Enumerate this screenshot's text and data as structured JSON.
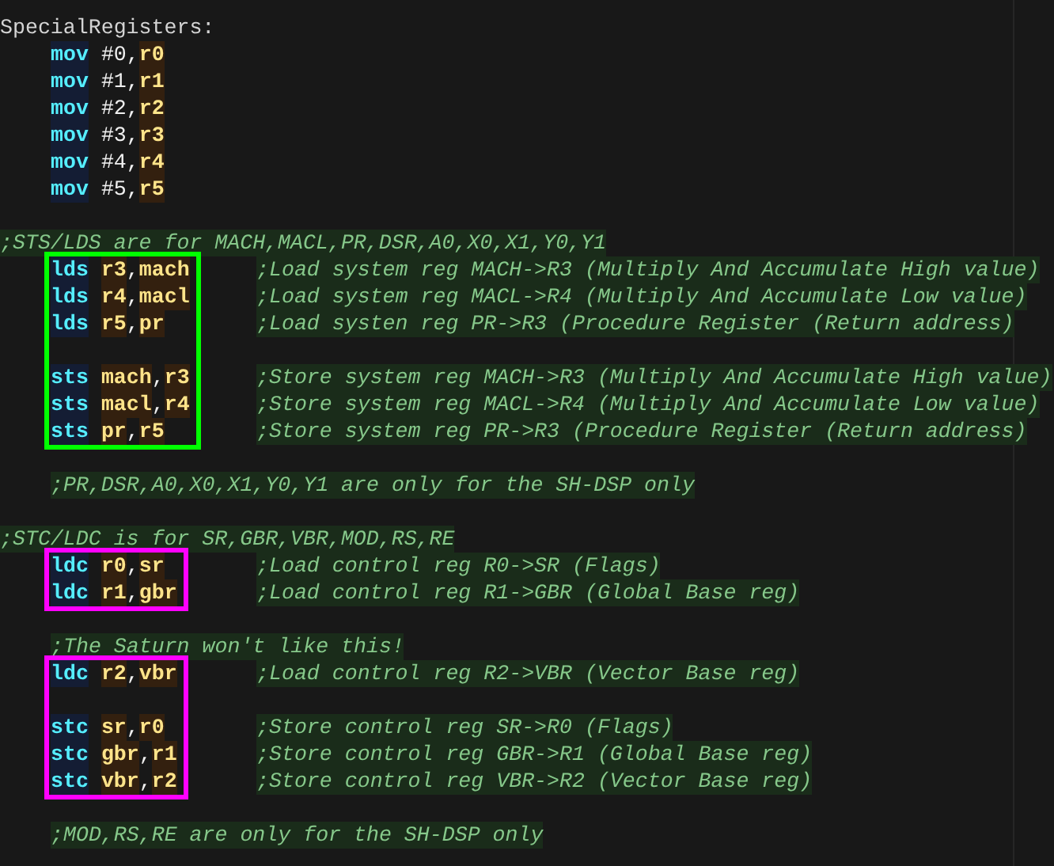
{
  "lines": [
    {
      "kind": "label",
      "text": "SpecialRegisters:"
    },
    {
      "kind": "instr",
      "op": "mov",
      "args": [
        {
          "kind": "imm",
          "text": "#0"
        },
        {
          "kind": "sep",
          "text": ","
        },
        {
          "kind": "reg",
          "text": "r0"
        }
      ]
    },
    {
      "kind": "instr",
      "op": "mov",
      "args": [
        {
          "kind": "imm",
          "text": "#1"
        },
        {
          "kind": "sep",
          "text": ","
        },
        {
          "kind": "reg",
          "text": "r1"
        }
      ]
    },
    {
      "kind": "instr",
      "op": "mov",
      "args": [
        {
          "kind": "imm",
          "text": "#2"
        },
        {
          "kind": "sep",
          "text": ","
        },
        {
          "kind": "reg",
          "text": "r2"
        }
      ]
    },
    {
      "kind": "instr",
      "op": "mov",
      "args": [
        {
          "kind": "imm",
          "text": "#3"
        },
        {
          "kind": "sep",
          "text": ","
        },
        {
          "kind": "reg",
          "text": "r3"
        }
      ]
    },
    {
      "kind": "instr",
      "op": "mov",
      "args": [
        {
          "kind": "imm",
          "text": "#4"
        },
        {
          "kind": "sep",
          "text": ","
        },
        {
          "kind": "reg",
          "text": "r4"
        }
      ]
    },
    {
      "kind": "instr",
      "op": "mov",
      "args": [
        {
          "kind": "imm",
          "text": "#5"
        },
        {
          "kind": "sep",
          "text": ","
        },
        {
          "kind": "reg",
          "text": "r5"
        }
      ]
    },
    {
      "kind": "blank"
    },
    {
      "kind": "comment",
      "indented": false,
      "text": ";STS/LDS are for MACH,MACL,PR,DSR,A0,X0,X1,Y0,Y1"
    },
    {
      "kind": "block",
      "color": "#00ff00",
      "rows": [
        {
          "kind": "instr",
          "op": "lds",
          "args": [
            {
              "kind": "reg",
              "text": "r3"
            },
            {
              "kind": "sep",
              "text": ","
            },
            {
              "kind": "reg",
              "text": "mach"
            }
          ],
          "comment": ";Load system reg MACH->R3 (Multiply And Accumulate High value)"
        },
        {
          "kind": "instr",
          "op": "lds",
          "args": [
            {
              "kind": "reg",
              "text": "r4"
            },
            {
              "kind": "sep",
              "text": ","
            },
            {
              "kind": "reg",
              "text": "macl"
            }
          ],
          "comment": ";Load system reg MACL->R4 (Multiply And Accumulate Low value)"
        },
        {
          "kind": "instr",
          "op": "lds",
          "args": [
            {
              "kind": "reg",
              "text": "r5"
            },
            {
              "kind": "sep",
              "text": ","
            },
            {
              "kind": "reg",
              "text": "pr"
            }
          ],
          "comment": ";Load systen reg PR->R3 (Procedure Register (Return address)"
        },
        {
          "kind": "blank"
        },
        {
          "kind": "instr",
          "op": "sts",
          "args": [
            {
              "kind": "reg",
              "text": "mach"
            },
            {
              "kind": "sep",
              "text": ","
            },
            {
              "kind": "reg",
              "text": "r3"
            }
          ],
          "comment": ";Store system reg MACH->R3 (Multiply And Accumulate High value)"
        },
        {
          "kind": "instr",
          "op": "sts",
          "args": [
            {
              "kind": "reg",
              "text": "macl"
            },
            {
              "kind": "sep",
              "text": ","
            },
            {
              "kind": "reg",
              "text": "r4"
            }
          ],
          "comment": ";Store system reg MACL->R4 (Multiply And Accumulate Low value)"
        },
        {
          "kind": "instr",
          "op": "sts",
          "args": [
            {
              "kind": "reg",
              "text": "pr"
            },
            {
              "kind": "sep",
              "text": ","
            },
            {
              "kind": "reg",
              "text": "r5"
            }
          ],
          "comment": ";Store system reg PR->R3 (Procedure Register (Return address)"
        }
      ]
    },
    {
      "kind": "blank"
    },
    {
      "kind": "comment",
      "indented": true,
      "text": ";PR,DSR,A0,X0,X1,Y0,Y1 are only for the SH-DSP only"
    },
    {
      "kind": "blank"
    },
    {
      "kind": "comment",
      "indented": false,
      "text": ";STC/LDC is for SR,GBR,VBR,MOD,RS,RE"
    },
    {
      "kind": "block",
      "color": "#ff00ff",
      "rows": [
        {
          "kind": "instr",
          "op": "ldc",
          "args": [
            {
              "kind": "reg",
              "text": "r0"
            },
            {
              "kind": "sep",
              "text": ","
            },
            {
              "kind": "reg",
              "text": "sr"
            }
          ],
          "comment": ";Load control reg R0->SR (Flags)"
        },
        {
          "kind": "instr",
          "op": "ldc",
          "args": [
            {
              "kind": "reg",
              "text": "r1"
            },
            {
              "kind": "sep",
              "text": ","
            },
            {
              "kind": "reg",
              "text": "gbr"
            }
          ],
          "comment": ";Load control reg R1->GBR (Global Base reg)"
        }
      ]
    },
    {
      "kind": "blank"
    },
    {
      "kind": "comment",
      "indented": true,
      "text": ";The Saturn won't like this!"
    },
    {
      "kind": "block",
      "color": "#ff00ff",
      "rows": [
        {
          "kind": "instr",
          "op": "ldc",
          "args": [
            {
              "kind": "reg",
              "text": "r2"
            },
            {
              "kind": "sep",
              "text": ","
            },
            {
              "kind": "reg",
              "text": "vbr"
            }
          ],
          "comment": ";Load control reg R2->VBR (Vector Base reg)"
        },
        {
          "kind": "blank"
        },
        {
          "kind": "instr",
          "op": "stc",
          "args": [
            {
              "kind": "reg",
              "text": "sr"
            },
            {
              "kind": "sep",
              "text": ","
            },
            {
              "kind": "reg",
              "text": "r0"
            }
          ],
          "comment": ";Store control reg SR->R0 (Flags)"
        },
        {
          "kind": "instr",
          "op": "stc",
          "args": [
            {
              "kind": "reg",
              "text": "gbr"
            },
            {
              "kind": "sep",
              "text": ","
            },
            {
              "kind": "reg",
              "text": "r1"
            }
          ],
          "comment": ";Store control reg GBR->R1 (Global Base reg)"
        },
        {
          "kind": "instr",
          "op": "stc",
          "args": [
            {
              "kind": "reg",
              "text": "vbr"
            },
            {
              "kind": "sep",
              "text": ","
            },
            {
              "kind": "reg",
              "text": "r2"
            }
          ],
          "comment": ";Store control reg VBR->R2 (Vector Base reg)"
        }
      ]
    },
    {
      "kind": "blank"
    },
    {
      "kind": "comment",
      "indented": true,
      "text": ";MOD,RS,RE are only for the SH-DSP only"
    }
  ]
}
